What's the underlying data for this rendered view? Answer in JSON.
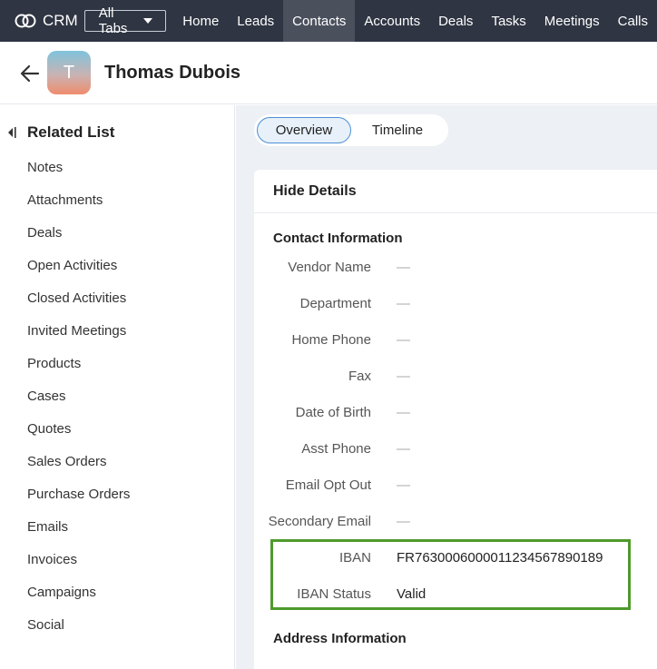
{
  "topnav": {
    "brand": "CRM",
    "all_tabs": "All Tabs",
    "tabs": [
      "Home",
      "Leads",
      "Contacts",
      "Accounts",
      "Deals",
      "Tasks",
      "Meetings",
      "Calls"
    ],
    "active_tab": "Contacts"
  },
  "record": {
    "avatar_initial": "T",
    "name": "Thomas Dubois"
  },
  "sidebar": {
    "title": "Related List",
    "items": [
      "Notes",
      "Attachments",
      "Deals",
      "Open Activities",
      "Closed Activities",
      "Invited Meetings",
      "Products",
      "Cases",
      "Quotes",
      "Sales Orders",
      "Purchase Orders",
      "Emails",
      "Invoices",
      "Campaigns",
      "Social"
    ]
  },
  "view_toggle": {
    "overview": "Overview",
    "timeline": "Timeline",
    "selected": "Overview"
  },
  "details": {
    "hide_label": "Hide Details",
    "contact_section": "Contact Information",
    "fields": [
      {
        "label": "Vendor Name",
        "value": "—"
      },
      {
        "label": "Department",
        "value": "—"
      },
      {
        "label": "Home Phone",
        "value": "—"
      },
      {
        "label": "Fax",
        "value": "—"
      },
      {
        "label": "Date of Birth",
        "value": "—"
      },
      {
        "label": "Asst Phone",
        "value": "—"
      },
      {
        "label": "Email Opt Out",
        "value": "—"
      },
      {
        "label": "Secondary Email",
        "value": "—"
      },
      {
        "label": "IBAN",
        "value": "FR7630006000011234567890189"
      },
      {
        "label": "IBAN Status",
        "value": "Valid"
      }
    ],
    "address_section": "Address Information"
  },
  "colors": {
    "nav_bg": "#2f3542",
    "highlight_border": "#4e9a2b",
    "overview_accent": "#4d90d6"
  }
}
